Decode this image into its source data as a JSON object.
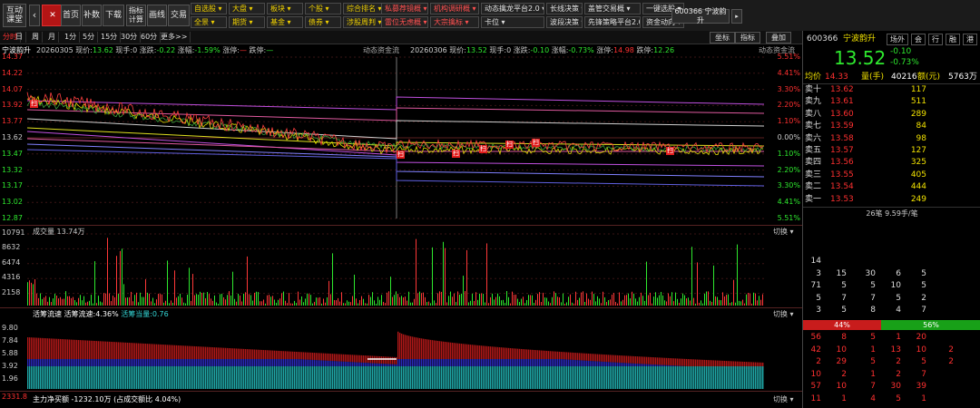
{
  "toolbar": {
    "interactive_class": "互动\n课堂",
    "home": "首页",
    "backfill": "补数",
    "download": "下载",
    "indicator_calc": "指标\n计算",
    "draw_line": "画线",
    "trade": "交易",
    "menus": [
      {
        "label": "自选股",
        "style": "yl"
      },
      {
        "label": "大盘",
        "style": "yl"
      },
      {
        "label": "板块",
        "style": "yl"
      },
      {
        "label": "个股",
        "style": "yl"
      },
      {
        "label": "综合排名",
        "style": "yl"
      },
      {
        "label": "全景",
        "style": "yl"
      },
      {
        "label": "期货",
        "style": "yl"
      },
      {
        "label": "基金",
        "style": "yl"
      },
      {
        "label": "债券",
        "style": "yl"
      },
      {
        "label": "涉股周判",
        "style": "yl"
      }
    ],
    "menus2": [
      {
        "label": "私募荐镜概",
        "style": "rd"
      },
      {
        "label": "机构调研概",
        "style": "rd"
      },
      {
        "label": "动态擒龙平台2.0",
        "style": ""
      },
      {
        "label": "长线决策",
        "style": ""
      },
      {
        "label": "盖管交易概",
        "style": ""
      },
      {
        "label": "一键选股",
        "style": ""
      },
      {
        "label": "雷位无虑概",
        "style": "rd"
      },
      {
        "label": "大宗擒标",
        "style": "rd"
      },
      {
        "label": "卡位",
        "style": ""
      },
      {
        "label": "波段决策",
        "style": ""
      },
      {
        "label": "先锋策略平台2.0",
        "style": ""
      },
      {
        "label": "资金动向",
        "style": ""
      }
    ],
    "stock_tab": "600366 宁波韵升"
  },
  "periodbar": {
    "items": [
      "分时",
      "日",
      "周",
      "月",
      "1分",
      "5分",
      "15分",
      "30分",
      "60分",
      "更多>>"
    ],
    "active": 0,
    "tools": [
      "坐标",
      "指标",
      "叠加"
    ]
  },
  "price_panel": {
    "title": "宁波韵升",
    "day1": {
      "date": "20260305",
      "price_label": "现价:",
      "price": "13.62",
      "hand_label": "现手:",
      "hand": "0",
      "chg_label": "涨跌:",
      "chg": "-0.22",
      "amp_label": "涨幅:",
      "amp": "-1.59%",
      "up_stop_label": "涨停:",
      "up_stop": "—",
      "down_stop_label": "跌停:",
      "down_stop": "—"
    },
    "day2": {
      "date": "20260306",
      "price_label": "现价:",
      "price": "13.52",
      "hand_label": "现手:",
      "hand": "0",
      "chg_label": "涨跌:",
      "chg": "-0.10",
      "amp_label": "涨幅:",
      "amp": "-0.73%",
      "up_stop_label": "涨停:",
      "up_stop": "14.98",
      "down_stop_label": "跌停:",
      "down_stop": "12.26"
    },
    "overlay_label1": "动态资金流",
    "overlay_label2": "动态资金流",
    "left_axis": [
      "14.37",
      "14.22",
      "14.07",
      "13.92",
      "13.77",
      "13.62",
      "13.47",
      "13.32",
      "13.17",
      "13.02",
      "12.87"
    ],
    "right_axis": [
      "5.51%",
      "4.41%",
      "3.30%",
      "2.20%",
      "1.10%",
      "0.00%",
      "1.10%",
      "2.20%",
      "3.30%",
      "4.41%",
      "5.51%"
    ],
    "scan_tag": "扫"
  },
  "volume_panel": {
    "title": "成交量",
    "value": "13.74万",
    "switch": "切换",
    "axis": [
      "10791",
      "8632",
      "6474",
      "4316",
      "2158"
    ]
  },
  "flow_panel": {
    "title": "活筹流速",
    "speed_label": "活筹流速:",
    "speed": "4.36%",
    "active_label": "活筹当量:",
    "active": "0.76",
    "switch": "切换",
    "axis": [
      "9.80",
      "7.84",
      "5.88",
      "3.92",
      "1.96"
    ]
  },
  "net_panel": {
    "axis_top": "2331.8",
    "title": "主力净买额",
    "value": "-1232.10万",
    "ratio": "(占成交额比 4.04%)",
    "switch": "切换"
  },
  "quote": {
    "code": "600366",
    "name": "宁波韵升",
    "tabs": [
      "场外",
      "会",
      "行",
      "融",
      "港"
    ],
    "price": "13.52",
    "chg": "-0.10",
    "pct": "-0.73%",
    "avg_label": "均价",
    "avg": "14.33",
    "vol_label": "量(手)",
    "vol": "40216",
    "amt_label": "额(元)",
    "amt": "5763万",
    "asks": [
      {
        "label": "卖十",
        "price": "13.62",
        "qty": "117"
      },
      {
        "label": "卖九",
        "price": "13.61",
        "qty": "511"
      },
      {
        "label": "卖八",
        "price": "13.60",
        "qty": "289"
      },
      {
        "label": "卖七",
        "price": "13.59",
        "qty": "84"
      },
      {
        "label": "卖六",
        "price": "13.58",
        "qty": "98"
      },
      {
        "label": "卖五",
        "price": "13.57",
        "qty": "127"
      },
      {
        "label": "卖四",
        "price": "13.56",
        "qty": "325"
      },
      {
        "label": "卖三",
        "price": "13.55",
        "qty": "405"
      },
      {
        "label": "卖二",
        "price": "13.54",
        "qty": "444"
      },
      {
        "label": "卖一",
        "price": "13.53",
        "qty": "249"
      }
    ],
    "queue_header": "26笔 9.59手/笔",
    "queue_rows": [
      [
        "14",
        "",
        "",
        "",
        "",
        ""
      ],
      [
        "3",
        "15",
        "30",
        "6",
        "5",
        ""
      ],
      [
        "71",
        "5",
        "5",
        "10",
        "5",
        ""
      ],
      [
        "5",
        "7",
        "7",
        "5",
        "2",
        ""
      ],
      [
        "3",
        "5",
        "8",
        "4",
        "7",
        ""
      ]
    ],
    "ratio_left": "44%",
    "ratio_right": "56%",
    "bid_rows": [
      [
        "56",
        "8",
        "5",
        "1",
        "20"
      ],
      [
        "42",
        "10",
        "1",
        "13",
        "10",
        "2"
      ],
      [
        "2",
        "29",
        "5",
        "2",
        "5",
        "2"
      ],
      [
        "10",
        "2",
        "1",
        "2",
        "7",
        ""
      ],
      [
        "57",
        "10",
        "7",
        "30",
        "39",
        ""
      ],
      [
        "11",
        "1",
        "4",
        "5",
        "1",
        ""
      ]
    ]
  },
  "chart_data": {
    "type": "line",
    "title": "宁波韵升",
    "x": [
      "20260305",
      "20260306"
    ],
    "series": [
      {
        "name": "现价",
        "values": [
          13.62,
          13.52
        ]
      }
    ],
    "ylim": [
      12.87,
      14.37
    ],
    "xlabel": "",
    "ylabel": ""
  },
  "colors": {
    "up": "#ff3030",
    "down": "#2ee82e",
    "price": "#ffffff",
    "avg": "#f0e000"
  }
}
